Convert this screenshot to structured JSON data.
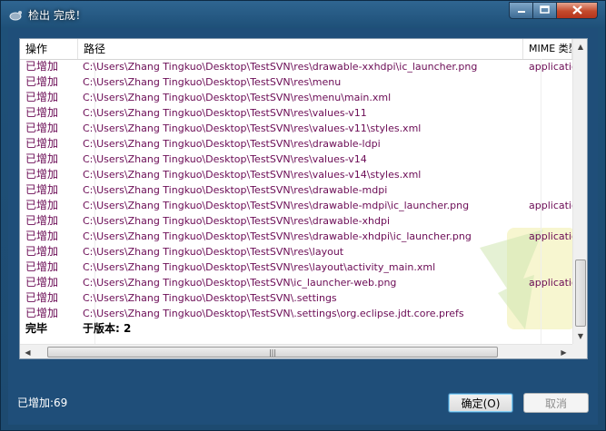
{
  "window": {
    "title": "检出 完成！"
  },
  "table": {
    "columns": {
      "operation": "操作",
      "path": "路径",
      "mime": "MIME 类型"
    },
    "rows": [
      {
        "op": "已增加",
        "path": "C:\\Users\\Zhang Tingkuo\\Desktop\\TestSVN\\res\\drawable-xxhdpi\\ic_launcher.png",
        "mime": "application"
      },
      {
        "op": "已增加",
        "path": "C:\\Users\\Zhang Tingkuo\\Desktop\\TestSVN\\res\\menu",
        "mime": ""
      },
      {
        "op": "已增加",
        "path": "C:\\Users\\Zhang Tingkuo\\Desktop\\TestSVN\\res\\menu\\main.xml",
        "mime": ""
      },
      {
        "op": "已增加",
        "path": "C:\\Users\\Zhang Tingkuo\\Desktop\\TestSVN\\res\\values-v11",
        "mime": ""
      },
      {
        "op": "已增加",
        "path": "C:\\Users\\Zhang Tingkuo\\Desktop\\TestSVN\\res\\values-v11\\styles.xml",
        "mime": ""
      },
      {
        "op": "已增加",
        "path": "C:\\Users\\Zhang Tingkuo\\Desktop\\TestSVN\\res\\drawable-ldpi",
        "mime": ""
      },
      {
        "op": "已增加",
        "path": "C:\\Users\\Zhang Tingkuo\\Desktop\\TestSVN\\res\\values-v14",
        "mime": ""
      },
      {
        "op": "已增加",
        "path": "C:\\Users\\Zhang Tingkuo\\Desktop\\TestSVN\\res\\values-v14\\styles.xml",
        "mime": ""
      },
      {
        "op": "已增加",
        "path": "C:\\Users\\Zhang Tingkuo\\Desktop\\TestSVN\\res\\drawable-mdpi",
        "mime": ""
      },
      {
        "op": "已增加",
        "path": "C:\\Users\\Zhang Tingkuo\\Desktop\\TestSVN\\res\\drawable-mdpi\\ic_launcher.png",
        "mime": "application"
      },
      {
        "op": "已增加",
        "path": "C:\\Users\\Zhang Tingkuo\\Desktop\\TestSVN\\res\\drawable-xhdpi",
        "mime": ""
      },
      {
        "op": "已增加",
        "path": "C:\\Users\\Zhang Tingkuo\\Desktop\\TestSVN\\res\\drawable-xhdpi\\ic_launcher.png",
        "mime": "application"
      },
      {
        "op": "已增加",
        "path": "C:\\Users\\Zhang Tingkuo\\Desktop\\TestSVN\\res\\layout",
        "mime": ""
      },
      {
        "op": "已增加",
        "path": "C:\\Users\\Zhang Tingkuo\\Desktop\\TestSVN\\res\\layout\\activity_main.xml",
        "mime": ""
      },
      {
        "op": "已增加",
        "path": "C:\\Users\\Zhang Tingkuo\\Desktop\\TestSVN\\ic_launcher-web.png",
        "mime": "application"
      },
      {
        "op": "已增加",
        "path": "C:\\Users\\Zhang Tingkuo\\Desktop\\TestSVN\\.settings",
        "mime": ""
      },
      {
        "op": "已增加",
        "path": "C:\\Users\\Zhang Tingkuo\\Desktop\\TestSVN\\.settings\\org.eclipse.jdt.core.prefs",
        "mime": ""
      }
    ],
    "footer": {
      "op": "完毕",
      "path": "于版本: 2"
    }
  },
  "status": {
    "text": "已增加:69"
  },
  "buttons": {
    "ok": "确定(O)",
    "cancel": "取消"
  },
  "icons": {
    "minimize": "minimize-icon",
    "maximize": "maximize-icon",
    "close": "close-icon"
  },
  "colors": {
    "added_text": "#6b0b55",
    "title_bg": "#1f4e79"
  }
}
